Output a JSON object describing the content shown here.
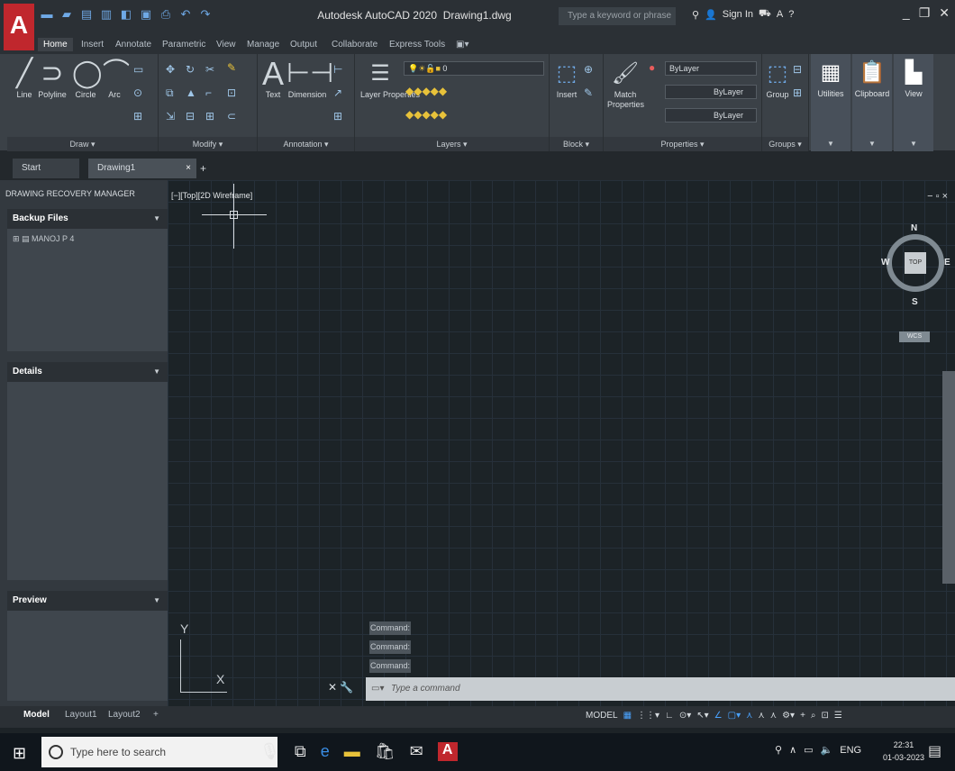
{
  "window": {
    "title": "Autodesk AutoCAD 2020",
    "document": "Drawing1.dwg",
    "search_placeholder": "Type a keyword or phrase",
    "sign_in": "Sign In",
    "logo": "A"
  },
  "ribbon_tabs": [
    "Home",
    "Insert",
    "Annotate",
    "Parametric",
    "View",
    "Manage",
    "Output",
    "Collaborate",
    "Express Tools"
  ],
  "ribbon": {
    "draw": {
      "line": "Line",
      "polyline": "Polyline",
      "circle": "Circle",
      "arc": "Arc",
      "label": "Draw ▾"
    },
    "modify": {
      "label": "Modify ▾"
    },
    "annotation": {
      "text": "Text",
      "dimension": "Dimension",
      "label": "Annotation ▾"
    },
    "layers": {
      "layer_properties": "Layer Properties",
      "layer_value": "0",
      "label": "Layers ▾"
    },
    "block": {
      "insert": "Insert",
      "label": "Block ▾"
    },
    "properties": {
      "match": "Match Properties",
      "bylayer1": "ByLayer",
      "bylayer2": "ByLayer",
      "bylayer3": "ByLayer",
      "label": "Properties ▾"
    },
    "groups": {
      "group": "Group",
      "label": "Groups ▾"
    },
    "utilities": "Utilities",
    "clipboard": "Clipboard",
    "view": "View"
  },
  "file_tabs": {
    "start": "Start",
    "drawing": "Drawing1",
    "close": "×",
    "plus": "+"
  },
  "palette": {
    "title": "DRAWING RECOVERY MANAGER",
    "backup_header": "Backup Files",
    "backup_item": "MANOJ P 4",
    "details_header": "Details",
    "preview_header": "Preview"
  },
  "canvas": {
    "view_label": "[−][Top][2D Wireframe]",
    "win_controls": "− ▫ ×",
    "viewcube": {
      "n": "N",
      "s": "S",
      "e": "E",
      "w": "W",
      "top": "TOP",
      "wcs": "WCS"
    },
    "ucs": {
      "x": "X",
      "y": "Y"
    }
  },
  "command": {
    "history": [
      "Command:",
      "Command:",
      "Command:"
    ],
    "placeholder": "Type a command"
  },
  "layout_tabs": [
    "Model",
    "Layout1",
    "Layout2",
    "+"
  ],
  "status": {
    "model": "MODEL"
  },
  "taskbar": {
    "search_placeholder": "Type here to search",
    "lang": "ENG",
    "time": "22:31",
    "date": "01-03-2023"
  }
}
